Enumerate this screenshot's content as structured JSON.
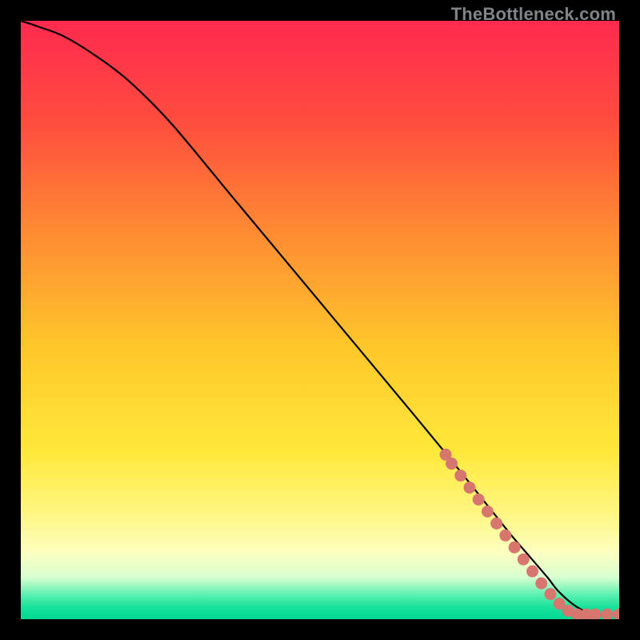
{
  "watermark": "TheBottleneck.com",
  "colors": {
    "frame_bg": "#000000",
    "curve": "#000000",
    "marker_fill": "#d7766f",
    "gradient_stops": [
      {
        "pct": 0,
        "color": "#ff2a4f"
      },
      {
        "pct": 16,
        "color": "#ff4a3f"
      },
      {
        "pct": 35,
        "color": "#ff8a33"
      },
      {
        "pct": 55,
        "color": "#ffc82a"
      },
      {
        "pct": 72,
        "color": "#ffe83a"
      },
      {
        "pct": 82,
        "color": "#fff680"
      },
      {
        "pct": 89,
        "color": "#fbffc0"
      },
      {
        "pct": 93,
        "color": "#d8ffd0"
      },
      {
        "pct": 96,
        "color": "#58f0b0"
      },
      {
        "pct": 98,
        "color": "#18e29a"
      },
      {
        "pct": 100,
        "color": "#00d896"
      }
    ]
  },
  "chart_data": {
    "type": "line",
    "title": "",
    "xlabel": "",
    "ylabel": "",
    "xlim": [
      0,
      100
    ],
    "ylim": [
      0,
      100
    ],
    "series": [
      {
        "name": "curve",
        "x": [
          0,
          3,
          7,
          12,
          18,
          25,
          35,
          45,
          55,
          65,
          72,
          78,
          82,
          85,
          88,
          90,
          93,
          96,
          100
        ],
        "y": [
          100,
          99,
          97.5,
          94.5,
          90,
          83,
          71,
          59,
          47,
          35,
          26.5,
          19,
          14,
          10.5,
          7,
          4.5,
          2,
          0.8,
          0.8
        ]
      }
    ],
    "markers": {
      "name": "highlighted-range",
      "points": [
        {
          "x": 71,
          "y": 27.5
        },
        {
          "x": 72,
          "y": 26
        },
        {
          "x": 73.5,
          "y": 24
        },
        {
          "x": 75,
          "y": 22
        },
        {
          "x": 76.5,
          "y": 20
        },
        {
          "x": 78,
          "y": 18
        },
        {
          "x": 79.5,
          "y": 16
        },
        {
          "x": 81,
          "y": 14
        },
        {
          "x": 82.5,
          "y": 12
        },
        {
          "x": 84,
          "y": 10
        },
        {
          "x": 85.5,
          "y": 8
        },
        {
          "x": 87,
          "y": 6
        },
        {
          "x": 88.5,
          "y": 4.2
        },
        {
          "x": 90,
          "y": 2.6
        },
        {
          "x": 91.5,
          "y": 1.4
        },
        {
          "x": 93,
          "y": 0.8
        },
        {
          "x": 94.5,
          "y": 0.8
        },
        {
          "x": 96,
          "y": 0.8
        },
        {
          "x": 98,
          "y": 0.8
        },
        {
          "x": 100,
          "y": 0.8
        }
      ]
    }
  }
}
